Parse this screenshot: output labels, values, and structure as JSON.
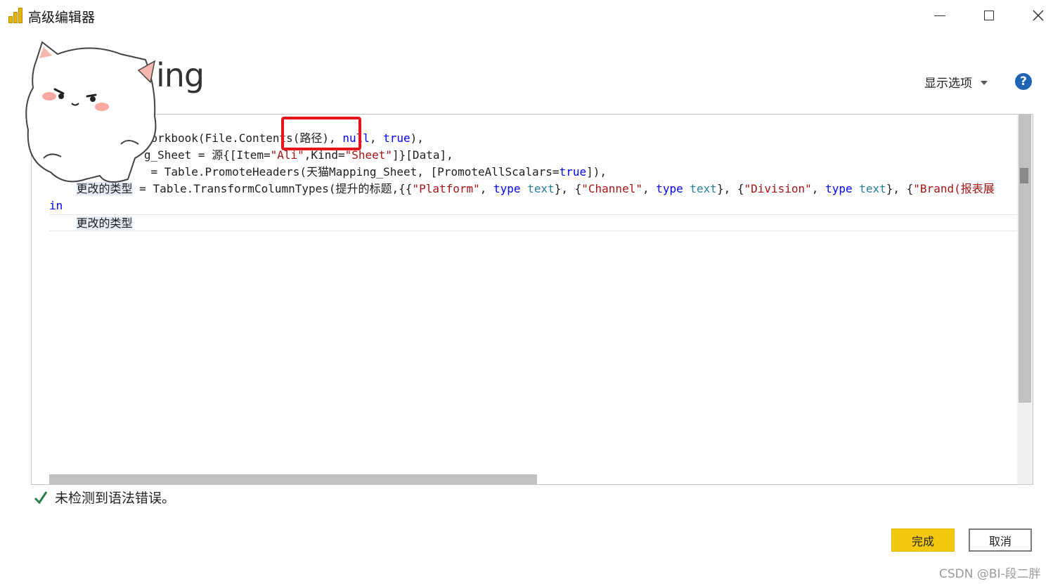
{
  "window": {
    "title": "高级编辑器",
    "minimize_glyph": "—",
    "maximize_glyph": "☐",
    "close_glyph": "✕"
  },
  "query_name_visible": "ing",
  "toolbar": {
    "display_options_label": "显示选项",
    "help_glyph": "?"
  },
  "editor": {
    "lines": [
      {
        "segments": [
          {
            "t": ".Workbook(File.Contents(路径), ",
            "c": ""
          },
          {
            "t": "null",
            "c": "kw"
          },
          {
            "t": ", ",
            "c": ""
          },
          {
            "t": "true",
            "c": "kw"
          },
          {
            "t": "),",
            "c": ""
          }
        ],
        "indent": "             "
      },
      {
        "segments": [
          {
            "t": "g_Sheet = 源{[Item=",
            "c": ""
          },
          {
            "t": "\"Ali\"",
            "c": "str"
          },
          {
            "t": ",Kind=",
            "c": ""
          },
          {
            "t": "\"Sheet\"",
            "c": "str"
          },
          {
            "t": "]}[Data],",
            "c": ""
          }
        ],
        "indent": "              "
      },
      {
        "segments": [
          {
            "t": " = Table.PromoteHeaders(天猫Mapping_Sheet, [PromoteAllScalars=",
            "c": ""
          },
          {
            "t": "true",
            "c": "kw"
          },
          {
            "t": "]),",
            "c": ""
          }
        ],
        "indent": "              "
      },
      {
        "segments": [
          {
            "t": "更改的类型",
            "c": "hl"
          },
          {
            "t": " = Table.TransformColumnTypes(提升的标题,{{",
            "c": ""
          },
          {
            "t": "\"Platform\"",
            "c": "str"
          },
          {
            "t": ", ",
            "c": ""
          },
          {
            "t": "type",
            "c": "kw"
          },
          {
            "t": " ",
            "c": ""
          },
          {
            "t": "text",
            "c": "ty"
          },
          {
            "t": "}, {",
            "c": ""
          },
          {
            "t": "\"Channel\"",
            "c": "str"
          },
          {
            "t": ", ",
            "c": ""
          },
          {
            "t": "type",
            "c": "kw"
          },
          {
            "t": " ",
            "c": ""
          },
          {
            "t": "text",
            "c": "ty"
          },
          {
            "t": "}, {",
            "c": ""
          },
          {
            "t": "\"Division\"",
            "c": "str"
          },
          {
            "t": ", ",
            "c": ""
          },
          {
            "t": "type",
            "c": "kw"
          },
          {
            "t": " ",
            "c": ""
          },
          {
            "t": "text",
            "c": "ty"
          },
          {
            "t": "}, {",
            "c": ""
          },
          {
            "t": "\"Brand(报表展",
            "c": "str"
          }
        ],
        "indent": "    "
      },
      {
        "segments": [
          {
            "t": "in",
            "c": "kw"
          }
        ],
        "indent": ""
      },
      {
        "segments": [
          {
            "t": "更改的类型",
            "c": "hl"
          }
        ],
        "indent": "    ",
        "current": true
      }
    ]
  },
  "status": {
    "message": "未检测到语法错误。"
  },
  "footer": {
    "done_label": "完成",
    "cancel_label": "取消"
  },
  "watermark": "CSDN @BI-段二胖",
  "colors": {
    "accent_yellow": "#f2c811",
    "highlight_red": "#e4161b",
    "status_green": "#2e7d4f",
    "help_blue": "#1f63b5"
  }
}
